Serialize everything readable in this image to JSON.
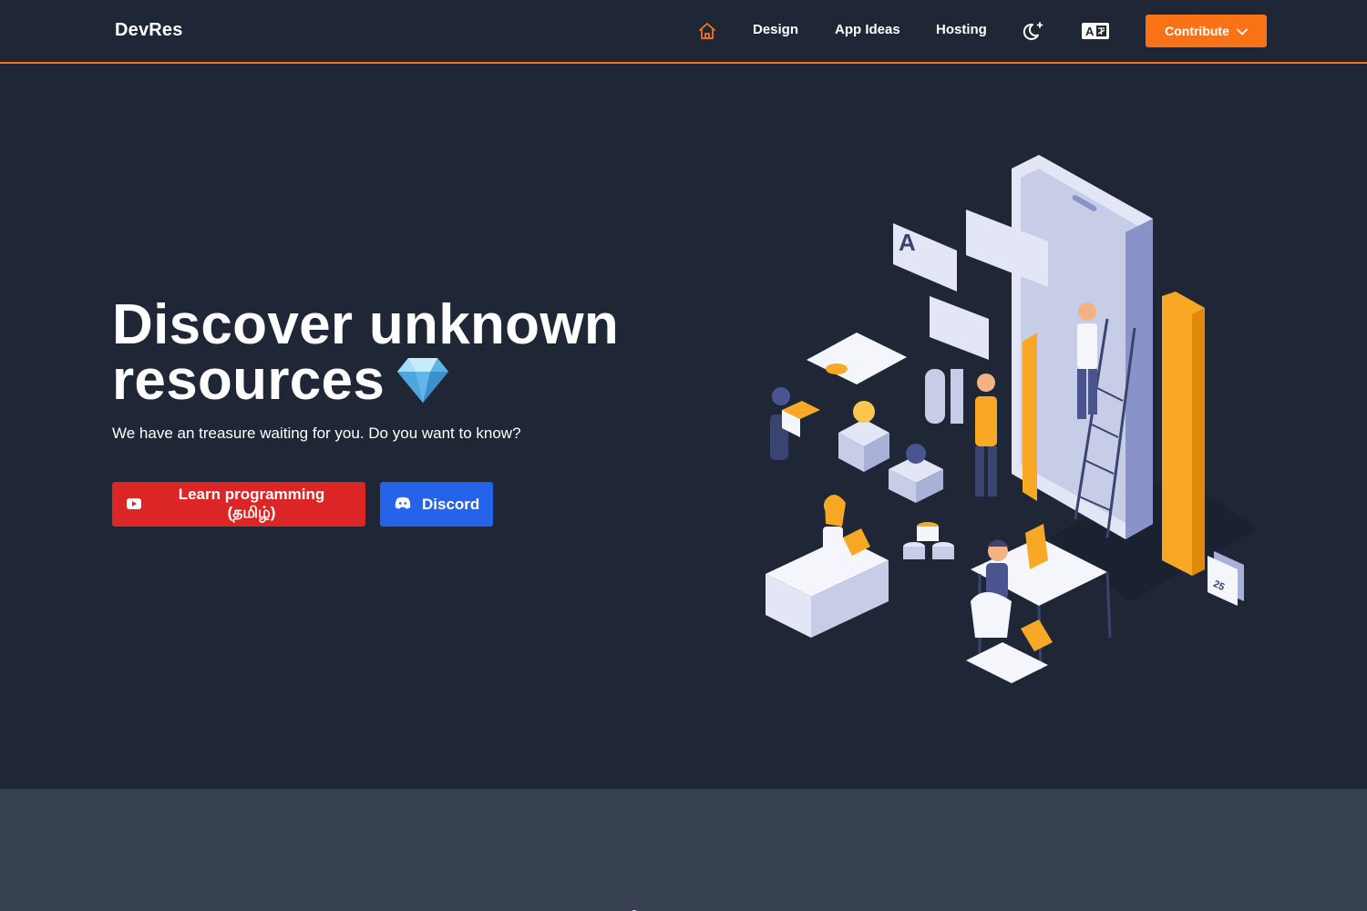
{
  "nav": {
    "brand": "DevRes",
    "home_icon": "home-icon",
    "links": [
      {
        "label": "Design"
      },
      {
        "label": "App Ideas"
      },
      {
        "label": "Hosting"
      }
    ],
    "theme_icon": "moon-sparkle-icon",
    "language_icon": "translate-icon",
    "contribute_label": "Contribute",
    "contribute_icon": "chevron-down-icon"
  },
  "hero": {
    "title_line1": "Discover unknown",
    "title_line2": "resources",
    "subtitle": "We have an treasure waiting for you. Do you want to know?",
    "primary_button": {
      "label": "Learn programming (தமிழ்)",
      "icon": "youtube-icon"
    },
    "secondary_button": {
      "label": "Discord",
      "icon": "discord-icon"
    }
  },
  "colors": {
    "background": "#1f2737",
    "accent": "#f97316",
    "youtube_red": "#dc2626",
    "discord_blue": "#2563eb",
    "lower_section": "#374151"
  }
}
